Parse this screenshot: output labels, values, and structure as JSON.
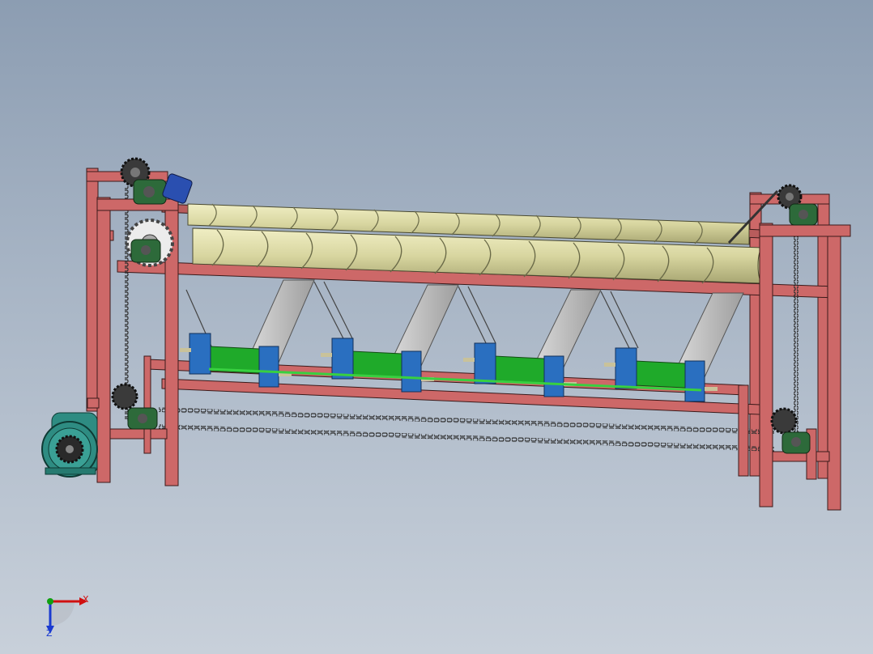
{
  "viewport": {
    "background_top": "#8c9db2",
    "background_bottom": "#c8d0da"
  },
  "model": {
    "colors": {
      "frame": "#cd6868",
      "frame_edge": "#3a1a1a",
      "roller": "#d8d6a0",
      "roller_edge": "#4a4a30",
      "chute": "#bfbfbf",
      "carriage_plate": "#1faa2a",
      "carriage_block": "#2a6fc0",
      "motor": "#2e8c82",
      "bearing": "#2d6a3a",
      "sprocket": "#3a3a3a",
      "chain": "#3a3a3a"
    },
    "parts": {
      "rollers_count": 2,
      "chutes_count": 4,
      "carriages_count": 4,
      "sprockets_count": 5
    }
  },
  "triad": {
    "x_label": "X",
    "z_label": "Z",
    "x_color": "#d01010",
    "z_color": "#1a3ad0",
    "y_color": "#10a010"
  }
}
